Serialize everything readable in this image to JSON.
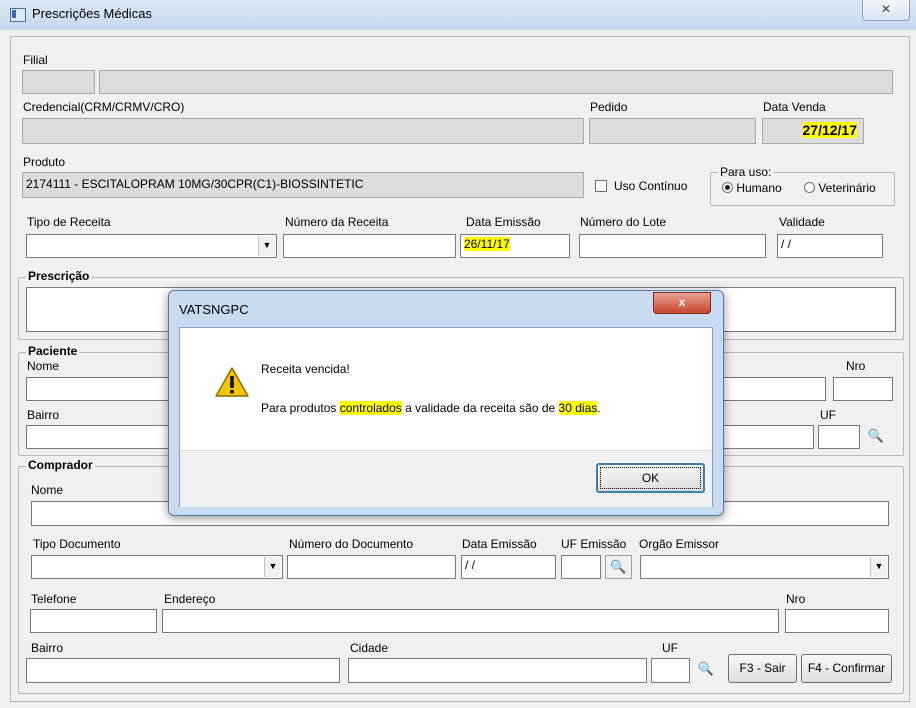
{
  "window": {
    "title": "Prescrições Médicas",
    "close_glyph": "✕",
    "icon": "app-window-icon"
  },
  "header": {
    "filial_label": "Filial",
    "credencial_label": "Credencial(CRM/CRMV/CRO)",
    "pedido_label": "Pedido",
    "data_venda_label": "Data Venda",
    "data_venda_value": "27/12/17",
    "produto_label": "Produto",
    "produto_value": "2174111 - ESCITALOPRAM 10MG/30CPR(C1)-BIOSSINTETIC",
    "uso_continuo_label": "Uso Contínuo",
    "para_uso_label": "Para uso:",
    "humano_label": "Humano",
    "veterinario_label": "Veterinário",
    "tipo_receita_label": "Tipo de Receita",
    "numero_receita_label": "Número da Receita",
    "data_emissao_label": "Data Emissão",
    "data_emissao_value": "26/11/17",
    "numero_lote_label": "Número do Lote",
    "validade_label": "Validade",
    "validade_value": "/ /"
  },
  "prescricao": {
    "title": "Prescrição"
  },
  "paciente": {
    "title": "Paciente",
    "nome_label": "Nome",
    "nro_label": "Nro",
    "bairro_label": "Bairro",
    "uf_label": "UF"
  },
  "comprador": {
    "title": "Comprador",
    "nome_label": "Nome",
    "tipo_documento_label": "Tipo Documento",
    "numero_documento_label": "Número do Documento",
    "data_emissao_label": "Data Emissão",
    "data_emissao_value": "/ /",
    "uf_emissao_label": "UF Emissão",
    "orgao_emissor_label": "Orgão Emissor",
    "telefone_label": "Telefone",
    "endereco_label": "Endereço",
    "nro_label": "Nro",
    "bairro_label": "Bairro",
    "cidade_label": "Cidade",
    "uf_label": "UF"
  },
  "buttons": {
    "sair": "F3 - Sair",
    "confirmar": "F4 - Confirmar"
  },
  "icons": {
    "search": "binoculars-icon",
    "combo": "▼"
  },
  "dialog": {
    "title": "VATSNGPC",
    "close_glyph": "x",
    "message_line1": "Receita vencida!",
    "message_pre": "Para produtos ",
    "message_hl1": "controlados",
    "message_mid": " a validade da receita são de ",
    "message_hl2": "30 dias",
    "message_post": ".",
    "ok": "OK"
  },
  "colors": {
    "highlight": "#ffff00",
    "dialog_frame": "#c8daf0",
    "warning": "#f5c400"
  }
}
